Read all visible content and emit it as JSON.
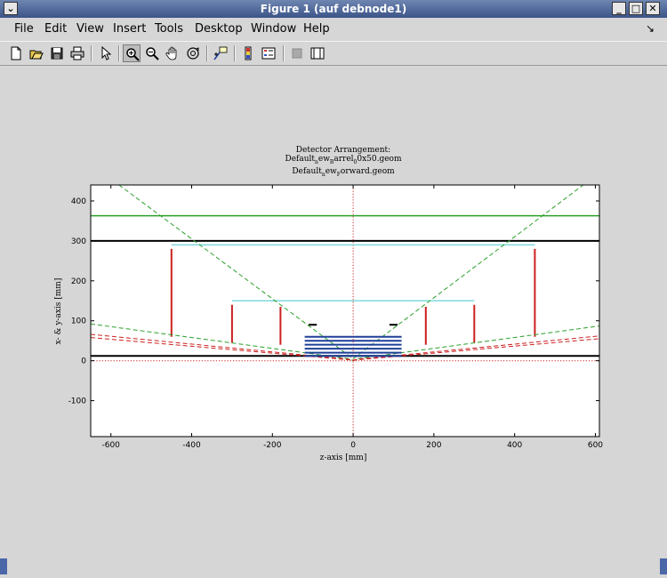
{
  "window": {
    "title": "Figure 1 (auf debnode1)",
    "menu_icon": "chevron-down-icon",
    "controls": [
      "minimize-icon",
      "maximize-icon",
      "close-icon"
    ]
  },
  "menubar": {
    "items": [
      "File",
      "Edit",
      "View",
      "Insert",
      "Tools",
      "Desktop",
      "Window",
      "Help"
    ],
    "corner_glyph": "↘"
  },
  "toolbar": {
    "buttons": [
      "new-figure-icon",
      "open-file-icon",
      "save-icon",
      "print-icon",
      "select-arrow-icon",
      "zoom-in-icon",
      "zoom-out-icon",
      "pan-hand-icon",
      "rotate-3d-icon",
      "data-cursor-icon",
      "colorbar-icon",
      "legend-icon",
      "hide-plot-tools-icon",
      "show-plot-tools-icon"
    ],
    "active": "zoom-in-icon"
  },
  "chart_data": {
    "type": "line",
    "title": [
      "Detector Arrangement:",
      "Default_new_Barrel_0x50.geom",
      "Default_new_Forward.geom"
    ],
    "title_rendered": [
      {
        "text": "Detector Arrangement:",
        "subs": []
      },
      {
        "text": "Default",
        "subs": [
          {
            "t": "n",
            "after": "Default"
          }
        ],
        "rest": "ew",
        "sub2": "B",
        "tail": "arrel",
        "sub3": "0",
        "tail2": "0x50.geom"
      },
      {
        "text": "Default",
        "rest": "ew",
        "sub2": "F",
        "tail": "orward.geom"
      }
    ],
    "xlabel": "z-axis [mm]",
    "ylabel": "x- & y-axis [mm]",
    "xlim": [
      -650,
      610
    ],
    "ylim": [
      -190,
      440
    ],
    "xticks": [
      -600,
      -400,
      -200,
      0,
      200,
      400,
      600
    ],
    "yticks": [
      -100,
      0,
      100,
      200,
      300,
      400
    ],
    "series": [
      {
        "style": "solid",
        "color": "#2aa02a",
        "x": [
          -650,
          610
        ],
        "y": [
          363,
          363
        ]
      },
      {
        "style": "solid",
        "color": "#000000",
        "x": [
          -650,
          610
        ],
        "y": [
          300,
          300
        ]
      },
      {
        "style": "solid",
        "color": "#000000",
        "x": [
          -650,
          610
        ],
        "y": [
          12,
          12
        ]
      },
      {
        "style": "dotted",
        "color": "#cc2020",
        "x": [
          -650,
          610
        ],
        "y": [
          0,
          0
        ]
      },
      {
        "style": "dotted",
        "color": "#cc2020",
        "x": [
          0,
          0
        ],
        "y": [
          -190,
          440
        ]
      },
      {
        "style": "solid",
        "color": "#7fd8df",
        "x": [
          -450,
          450
        ],
        "y": [
          290,
          290
        ]
      },
      {
        "style": "solid",
        "color": "#7fd8df",
        "x": [
          -300,
          300
        ],
        "y": [
          150,
          150
        ]
      },
      {
        "style": "solid",
        "color": "#cc2020",
        "x": [
          -450,
          -450
        ],
        "y": [
          60,
          280
        ]
      },
      {
        "style": "solid",
        "color": "#cc2020",
        "x": [
          450,
          450
        ],
        "y": [
          60,
          280
        ]
      },
      {
        "style": "solid",
        "color": "#cc2020",
        "x": [
          -300,
          -300
        ],
        "y": [
          45,
          140
        ]
      },
      {
        "style": "solid",
        "color": "#cc2020",
        "x": [
          300,
          300
        ],
        "y": [
          45,
          140
        ]
      },
      {
        "style": "solid",
        "color": "#cc2020",
        "x": [
          -180,
          -180
        ],
        "y": [
          40,
          135
        ]
      },
      {
        "style": "solid",
        "color": "#cc2020",
        "x": [
          180,
          180
        ],
        "y": [
          40,
          135
        ]
      },
      {
        "style": "dashed",
        "color": "#2aa02a",
        "x": [
          -650,
          -10,
          0,
          10,
          610
        ],
        "y": [
          92,
          5,
          0,
          5,
          87
        ]
      },
      {
        "style": "dashed",
        "color": "#2aa02a",
        "x": [
          -580,
          0,
          570
        ],
        "y": [
          440,
          5,
          440
        ]
      },
      {
        "style": "dashed",
        "color": "#cc2020",
        "x": [
          -650,
          -5,
          0,
          5,
          610
        ],
        "y": [
          66,
          3,
          0,
          3,
          62
        ]
      },
      {
        "style": "dashed",
        "color": "#cc2020",
        "x": [
          -650,
          -5,
          0,
          5,
          610
        ],
        "y": [
          58,
          2,
          0,
          2,
          55
        ]
      }
    ],
    "inner_barrel": {
      "color": "#1f3f9a",
      "x": [
        -120,
        120
      ],
      "y": [
        60,
        50,
        40,
        30,
        20,
        12
      ]
    },
    "small_marks": {
      "color": "#000000",
      "x": [
        [
          -110,
          -90
        ],
        [
          90,
          110
        ]
      ],
      "y": 90
    }
  }
}
